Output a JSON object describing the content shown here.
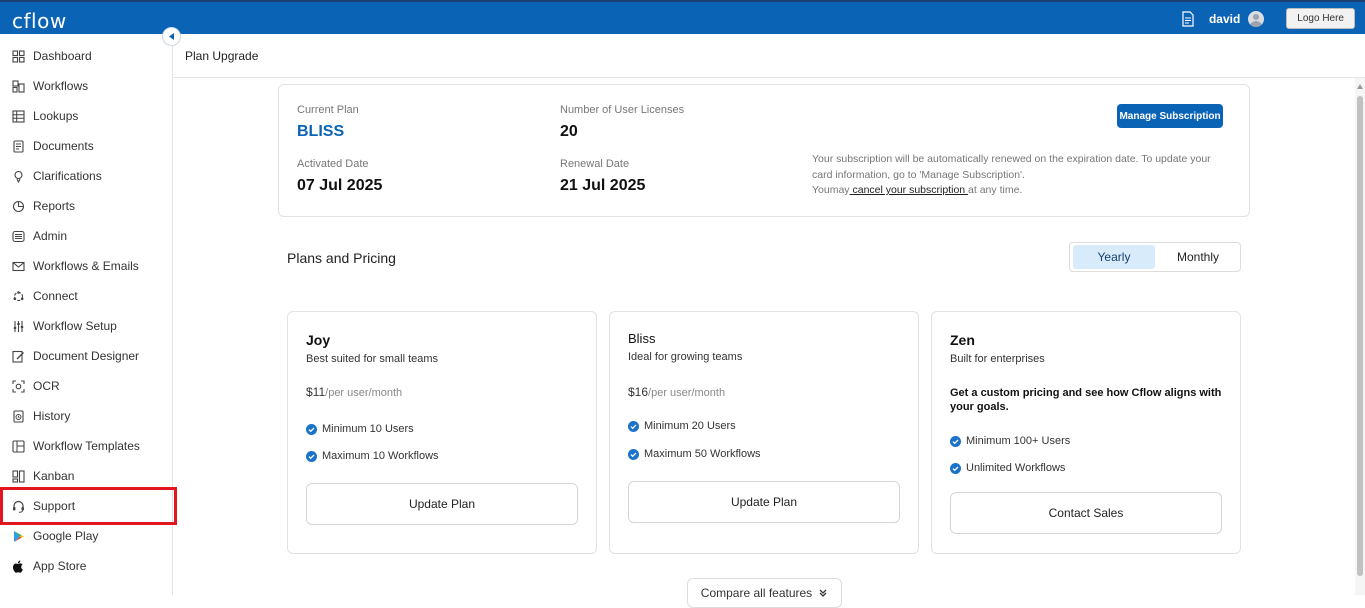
{
  "topbar": {
    "logo": "cflow",
    "username": "david",
    "logo_button": "Logo Here"
  },
  "sidebar": {
    "items": [
      {
        "label": "Dashboard",
        "icon": "dashboard-icon"
      },
      {
        "label": "Workflows",
        "icon": "workflows-icon"
      },
      {
        "label": "Lookups",
        "icon": "lookups-icon"
      },
      {
        "label": "Documents",
        "icon": "documents-icon"
      },
      {
        "label": "Clarifications",
        "icon": "clarifications-icon"
      },
      {
        "label": "Reports",
        "icon": "reports-icon"
      },
      {
        "label": "Admin",
        "icon": "admin-icon"
      },
      {
        "label": "Workflows & Emails",
        "icon": "mail-icon"
      },
      {
        "label": "Connect",
        "icon": "connect-icon"
      },
      {
        "label": "Workflow Setup",
        "icon": "setup-icon"
      },
      {
        "label": "Document Designer",
        "icon": "designer-icon"
      },
      {
        "label": "OCR",
        "icon": "ocr-icon"
      },
      {
        "label": "History",
        "icon": "history-icon"
      },
      {
        "label": "Workflow Templates",
        "icon": "templates-icon"
      },
      {
        "label": "Kanban",
        "icon": "kanban-icon"
      },
      {
        "label": "Support",
        "icon": "support-icon"
      },
      {
        "label": "Google Play",
        "icon": "google-play-icon"
      },
      {
        "label": "App Store",
        "icon": "apple-icon"
      }
    ]
  },
  "page": {
    "title": "Plan Upgrade"
  },
  "current_plan": {
    "current_plan_label": "Current Plan",
    "current_plan_value": "BLISS",
    "licenses_label": "Number of User Licenses",
    "licenses_value": "20",
    "activated_label": "Activated Date",
    "activated_value": "07 Jul 2025",
    "renewal_label": "Renewal Date",
    "renewal_value": "21 Jul 2025",
    "manage_button": "Manage Subscription",
    "renew_text": "Your subscription will be automatically renewed on the expiration date. To update your card information, go to 'Manage Subscription'.",
    "cancel_prefix": "Youmay",
    "cancel_link": " cancel your subscription ",
    "cancel_suffix": "at any time."
  },
  "pricing": {
    "title": "Plans and Pricing",
    "toggle_yearly": "Yearly",
    "toggle_monthly": "Monthly",
    "selected_period": "Yearly",
    "tiers": [
      {
        "name": "Joy",
        "desc": "Best suited for small teams",
        "price": "$11",
        "unit": "/per user/month",
        "features": [
          "Minimum 10 Users",
          "Maximum 10 Workflows"
        ],
        "button": "Update Plan"
      },
      {
        "name": "Bliss",
        "desc": "Ideal for growing teams",
        "price": "$16",
        "unit": "/per user/month",
        "features": [
          "Minimum 20 Users",
          "Maximum 50 Workflows"
        ],
        "button": "Update Plan"
      },
      {
        "name": "Zen",
        "desc": "Built for enterprises",
        "custom": "Get a custom pricing and see how Cflow aligns with your goals.",
        "features": [
          "Minimum 100+ Users",
          "Unlimited Workflows"
        ],
        "button": "Contact Sales"
      }
    ],
    "compare_button": "Compare all features"
  },
  "colors": {
    "brand": "#0b63b6",
    "highlight": "#e3151f",
    "check": "#1a73c9"
  }
}
